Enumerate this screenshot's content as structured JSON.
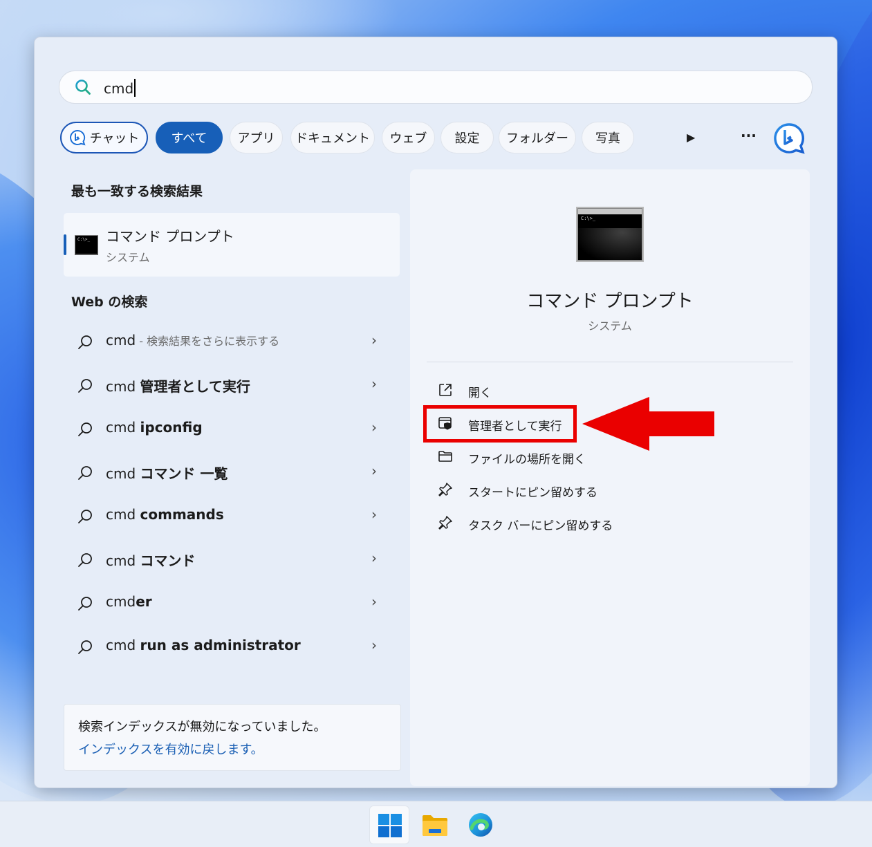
{
  "search": {
    "query": "cmd"
  },
  "filters": {
    "chat_label": "チャット",
    "tabs": [
      "すべて",
      "アプリ",
      "ドキュメント",
      "ウェブ",
      "設定",
      "フォルダー",
      "写真"
    ],
    "more_symbol": "▶",
    "overflow_symbol": "···"
  },
  "best_match": {
    "heading": "最も一致する検索結果",
    "title": "コマンド プロンプト",
    "subtitle": "システム"
  },
  "web": {
    "heading": "Web の検索",
    "items": [
      {
        "query": "cmd",
        "suggestion": "",
        "desc": " - 検索結果をさらに表示する"
      },
      {
        "query": "cmd ",
        "suggestion": "管理者として実行",
        "desc": ""
      },
      {
        "query": "cmd ",
        "suggestion": "ipconfig",
        "desc": ""
      },
      {
        "query": "cmd ",
        "suggestion": "コマンド 一覧",
        "desc": ""
      },
      {
        "query": "cmd ",
        "suggestion": "commands",
        "desc": ""
      },
      {
        "query": "cmd ",
        "suggestion": "コマンド",
        "desc": ""
      },
      {
        "query": "cmd",
        "suggestion": "er",
        "desc": ""
      },
      {
        "query": "cmd ",
        "suggestion": "run as administrator",
        "desc": ""
      }
    ],
    "chevron": "›"
  },
  "notice": {
    "message": "検索インデックスが無効になっていました。",
    "link": "インデックスを有効に戻します。"
  },
  "detail": {
    "title": "コマンド プロンプト",
    "subtitle": "システム",
    "icon_prompt": "C:\\>_",
    "actions": [
      {
        "icon": "open-external-icon",
        "label": "開く"
      },
      {
        "icon": "shield-window-icon",
        "label": "管理者として実行"
      },
      {
        "icon": "folder-icon",
        "label": "ファイルの場所を開く"
      },
      {
        "icon": "pin-icon",
        "label": "スタートにピン留めする"
      },
      {
        "icon": "pin-icon",
        "label": "タスク バーにピン留めする"
      }
    ]
  },
  "annotation": {
    "highlight_color": "#ea0000"
  },
  "colors": {
    "accent": "#175fb8",
    "link": "#1a5fb4"
  },
  "taskbar": {
    "items": [
      "start-icon",
      "file-explorer-icon",
      "edge-icon"
    ]
  }
}
